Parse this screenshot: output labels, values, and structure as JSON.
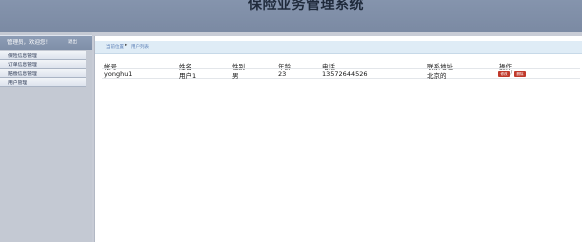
{
  "header": {
    "title": "保险业务管理系统"
  },
  "sidebar": {
    "welcome": "管理员，欢迎您！",
    "logout": "退出",
    "items": [
      {
        "label": "保险信息管理"
      },
      {
        "label": "订单信息管理"
      },
      {
        "label": "赔偿信息管理"
      },
      {
        "label": "用户管理"
      }
    ]
  },
  "breadcrumb": {
    "root": "当前位置",
    "separator": "▸",
    "current": "用户列表"
  },
  "table": {
    "columns": [
      "帐号",
      "姓名",
      "性别",
      "年龄",
      "电话",
      "联系地址",
      "操作"
    ],
    "rows": [
      {
        "account": "yonghu1",
        "name": "用户1",
        "gender": "男",
        "age": "23",
        "phone": "13572644526",
        "address": "北京的",
        "edit": "修改",
        "delete": "删除"
      }
    ]
  },
  "colors": {
    "header_bg": "#7b8aa3",
    "sidebar_bg": "#c4c9d3",
    "button_red": "#c0392b"
  }
}
